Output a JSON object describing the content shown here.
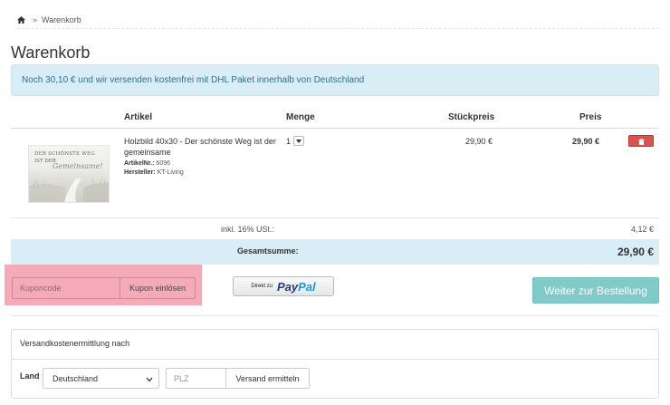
{
  "breadcrumb": {
    "home_icon": "home-icon",
    "separator": "»",
    "current": "Warenkorb"
  },
  "page_title": "Warenkorb",
  "shipping_notice": "Noch 30,10 € und wir versenden kostenfrei mit DHL Paket innerhalb von Deutschland",
  "cart_table": {
    "headers": {
      "article": "Artikel",
      "quantity": "Menge",
      "unit_price": "Stückpreis",
      "price": "Preis"
    },
    "items": [
      {
        "image_text_line1": "DER SCHÖNSTE WEG",
        "image_text_line2": "IST DER",
        "image_text_script": "Gemeinsame!",
        "name": "Holzbild 40x30 - Der schönste Weg ist der gemeinsame",
        "article_no_label": "ArtikelNr.:",
        "article_no": "6096",
        "manufacturer_label": "Hersteller:",
        "manufacturer": "KT-Living",
        "quantity": "1",
        "unit_price": "29,90 €",
        "total_price": "29,90 €"
      }
    ],
    "tax_label": "inkl. 16% USt.:",
    "tax_value": "4,12 €",
    "total_label": "Gesamtsumme:",
    "total_value": "29,90 €"
  },
  "coupon": {
    "placeholder": "Kuponcode",
    "button_label": "Kupon einlösen"
  },
  "paypal": {
    "prefix": "Direkt zu",
    "brand_pay": "Pay",
    "brand_pal": "Pal"
  },
  "checkout_label": "Weiter zur Bestellung",
  "shipping_calc": {
    "title": "Versandkostenermittlung nach",
    "land_label": "Land",
    "country": "Deutschland",
    "plz_placeholder": "PLZ",
    "button_label": "Versand ermitteln"
  },
  "colors": {
    "info_bg": "#d9edf7",
    "info_text": "#31708f",
    "delete_button": "#d9534f",
    "checkout_button": "#80cbc9",
    "coupon_highlight": "#f4a6b3"
  }
}
